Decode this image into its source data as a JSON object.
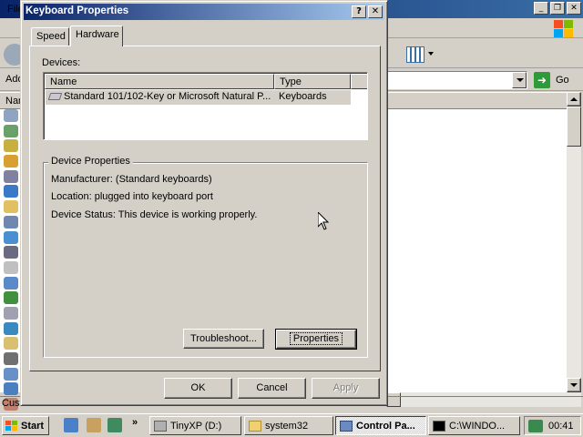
{
  "background_window": {
    "menu_partial": "File",
    "address_partial": "Add",
    "go_label": "Go",
    "header_partial": "Nam",
    "status_partial": "Cust"
  },
  "dialog": {
    "title": "Keyboard Properties",
    "title_buttons": {
      "help": "?",
      "close": "✕"
    },
    "tabs": [
      {
        "label": "Speed",
        "active": false
      },
      {
        "label": "Hardware",
        "active": true
      }
    ],
    "devices_label": "Devices:",
    "columns": [
      "Name",
      "Type"
    ],
    "device_rows": [
      {
        "name": "Standard 101/102-Key or Microsoft Natural P...",
        "type": "Keyboards",
        "selected": true
      }
    ],
    "device_properties": {
      "group_title": "Device Properties",
      "manufacturer": "Manufacturer: (Standard keyboards)",
      "location": "Location: plugged into keyboard port",
      "status": "Device Status: This device is working properly."
    },
    "buttons": {
      "troubleshoot": "Troubleshoot...",
      "properties": "Properties",
      "ok": "OK",
      "cancel": "Cancel",
      "apply": "Apply"
    }
  },
  "taskbar": {
    "start_label": "Start",
    "quick_launch_more": "»",
    "tasks": [
      {
        "label": "TinyXP (D:)",
        "icon": "drive-icon",
        "active": false
      },
      {
        "label": "system32",
        "icon": "folder-icon",
        "active": false
      },
      {
        "label": "Control Pa...",
        "icon": "control-panel-icon",
        "active": true
      },
      {
        "label": "C:\\WINDO...",
        "icon": "console-icon",
        "active": false
      }
    ],
    "clock": "00:41"
  },
  "colors": {
    "titlebar_active_start": "#0a246a",
    "titlebar_active_end": "#a6caf0",
    "face": "#d4d0c8"
  }
}
